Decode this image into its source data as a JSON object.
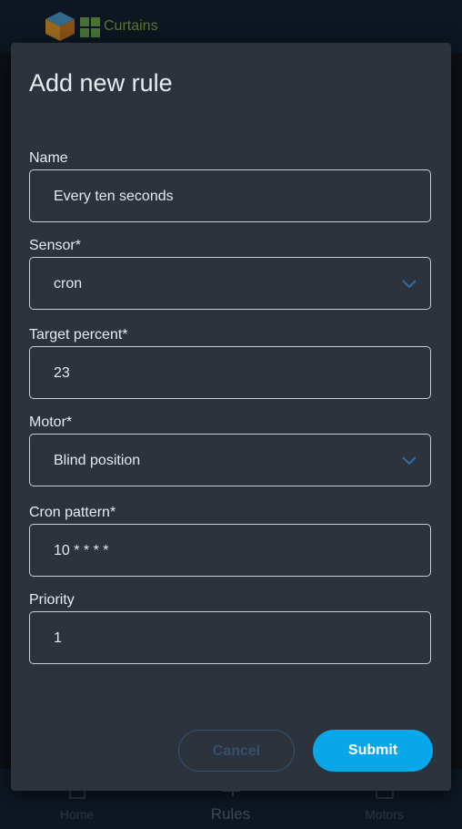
{
  "app": {
    "title": "Curtains",
    "colors": {
      "accent": "#07a7ea",
      "brand_green": "#7cb342",
      "surface": "#2c333d"
    }
  },
  "nav": {
    "items": [
      {
        "label": "Home",
        "icon": "home-icon",
        "active": false
      },
      {
        "label": "Rules",
        "icon": "rules-icon",
        "active": true
      },
      {
        "label": "Motors",
        "icon": "motors-icon",
        "active": false
      }
    ]
  },
  "dialog": {
    "title": "Add new rule",
    "fields": {
      "name": {
        "label": "Name",
        "value": "Every ten seconds"
      },
      "sensor": {
        "label": "Sensor*",
        "value": "cron"
      },
      "target": {
        "label": "Target percent*",
        "value": "23"
      },
      "motor": {
        "label": "Motor*",
        "value": "Blind position"
      },
      "cron": {
        "label": "Cron pattern*",
        "value": "10 * * * *"
      },
      "priority": {
        "label": "Priority",
        "value": "1"
      }
    },
    "cancel_label": "Cancel",
    "submit_label": "Submit"
  }
}
